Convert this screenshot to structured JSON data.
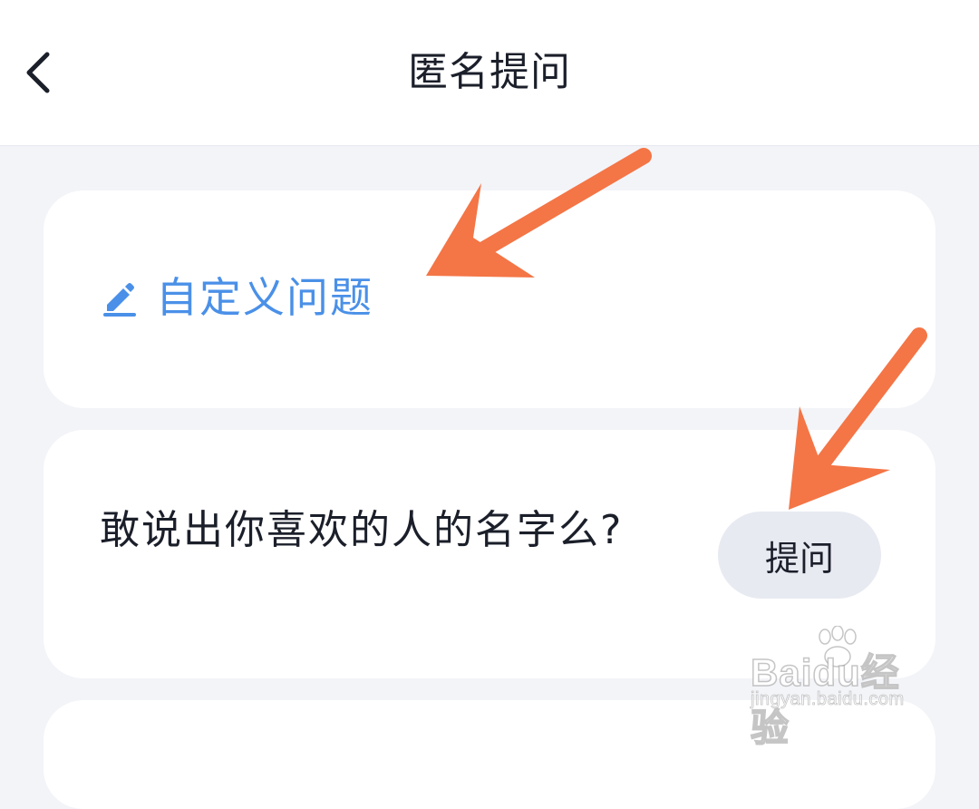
{
  "header": {
    "title": "匿名提问",
    "back_icon": "chevron-left-icon"
  },
  "custom_question": {
    "label": "自定义问题",
    "icon": "pencil-icon",
    "color": "#4a90e8"
  },
  "questions": [
    {
      "text": "敢说出你喜欢的人的名字么?",
      "button_label": "提问"
    }
  ],
  "watermark": {
    "logo": "Baidu经验",
    "url": "jingyan.baidu.com"
  },
  "colors": {
    "background": "#f3f4f8",
    "card": "#ffffff",
    "accent": "#4a90e8",
    "button_bg": "#e8eaf2",
    "annotation_arrow": "#f47546"
  }
}
